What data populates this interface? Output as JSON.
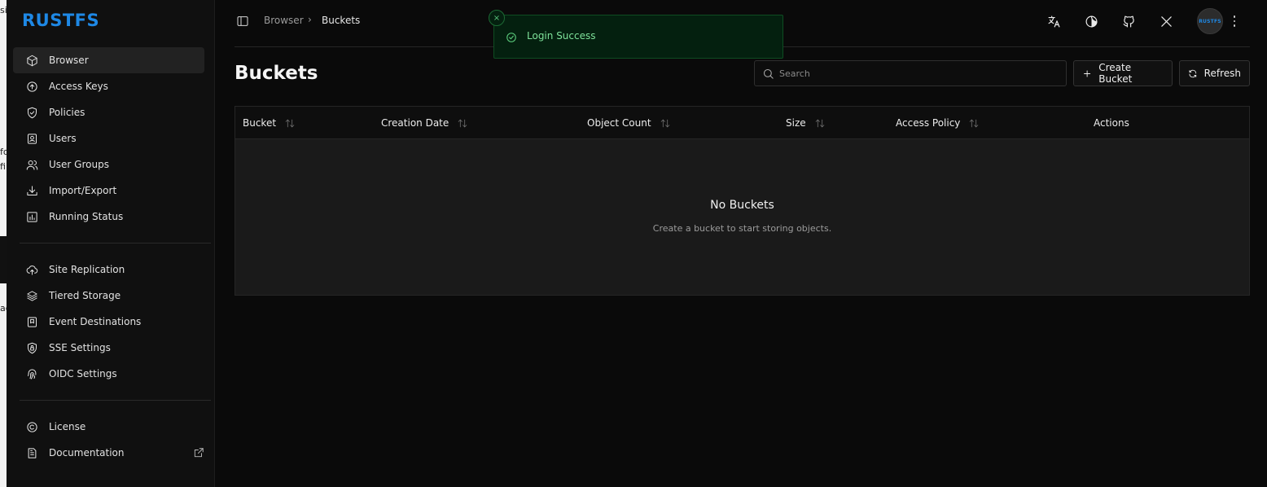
{
  "brand": {
    "logo_text": "RUSTFS",
    "accent": "#1e88e5"
  },
  "sidebar": {
    "items": [
      {
        "label": "Browser",
        "icon": "cube-icon",
        "active": true
      },
      {
        "label": "Access Keys",
        "icon": "key-circle-icon"
      },
      {
        "label": "Policies",
        "icon": "shield-check-icon"
      },
      {
        "label": "Users",
        "icon": "user-badge-icon"
      },
      {
        "label": "User Groups",
        "icon": "users-icon"
      },
      {
        "label": "Import/Export",
        "icon": "download-icon"
      },
      {
        "label": "Running Status",
        "icon": "bar-chart-icon"
      }
    ],
    "items2": [
      {
        "label": "Site Replication",
        "icon": "cloud-upload-icon"
      },
      {
        "label": "Tiered Storage",
        "icon": "layers-icon"
      },
      {
        "label": "Event Destinations",
        "icon": "bookmark-badge-icon"
      },
      {
        "label": "SSE Settings",
        "icon": "shield-lock-icon"
      },
      {
        "label": "OIDC Settings",
        "icon": "fingerprint-icon"
      }
    ],
    "items3": [
      {
        "label": "License",
        "icon": "copyright-icon"
      },
      {
        "label": "Documentation",
        "icon": "document-icon",
        "external_icon": "external-link-icon"
      }
    ]
  },
  "topbar": {
    "breadcrumb": [
      "Browser",
      "Buckets"
    ],
    "breadcrumb_separator": "›",
    "icons": [
      "translate-icon",
      "theme-icon",
      "github-icon",
      "x-icon"
    ],
    "avatar_text": "RUSTFS"
  },
  "toast": {
    "message": "Login Success",
    "close_symbol": "×",
    "status_color": "#5dd07f"
  },
  "main": {
    "title": "Buckets",
    "search_placeholder": "Search",
    "create_label": "Create Bucket",
    "refresh_label": "Refresh",
    "columns": [
      "Bucket",
      "Creation Date",
      "Object Count",
      "Size",
      "Access Policy",
      "Actions"
    ],
    "empty_title": "No Buckets",
    "empty_subtitle": "Create a bucket to start storing objects."
  },
  "underlying_window_glyphs": [
    "si",
    "fo",
    "fi",
    "ac"
  ]
}
